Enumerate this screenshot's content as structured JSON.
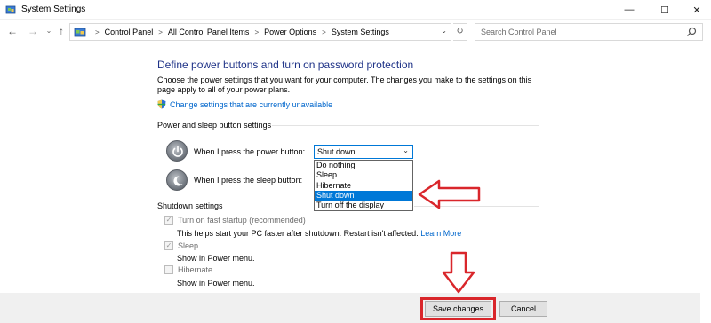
{
  "window": {
    "title": "System Settings",
    "controls": {
      "minimize": "—",
      "maximize": "☐",
      "close": "✕"
    }
  },
  "nav": {
    "back": "←",
    "forward": "→",
    "dropdown": "⌄",
    "up": "↑",
    "refresh": "↻",
    "breadcrumbs": [
      "Control Panel",
      "All Control Panel Items",
      "Power Options",
      "System Settings"
    ],
    "search_placeholder": "Search Control Panel"
  },
  "main": {
    "heading": "Define power buttons and turn on password protection",
    "description": "Choose the power settings that you want for your computer. The changes you make to the settings on this page apply to all of your power plans.",
    "change_link": "Change settings that are currently unavailable",
    "power_sleep_group": "Power and sleep button settings",
    "power_button_label": "When I press the power button:",
    "sleep_button_label": "When I press the sleep button:",
    "power_button_value": "Shut down",
    "dropdown_options": [
      "Do nothing",
      "Sleep",
      "Hibernate",
      "Shut down",
      "Turn off the display"
    ],
    "selected_option": "Shut down",
    "shutdown_group": "Shutdown settings",
    "fast_startup_label": "Turn on fast startup (recommended)",
    "fast_startup_desc": "This helps start your PC faster after shutdown. Restart isn't affected.",
    "learn_more": "Learn More",
    "fast_startup_checked": true,
    "sleep_label": "Sleep",
    "sleep_desc": "Show in Power menu.",
    "sleep_checked": true,
    "hibernate_label": "Hibernate",
    "hibernate_desc": "Show in Power menu.",
    "hibernate_checked": false
  },
  "footer": {
    "save_label": "Save changes",
    "cancel_label": "Cancel"
  },
  "colors": {
    "heading": "#1e3287",
    "link": "#0066cc",
    "selection": "#0078d7",
    "annotation": "#d9262b"
  }
}
